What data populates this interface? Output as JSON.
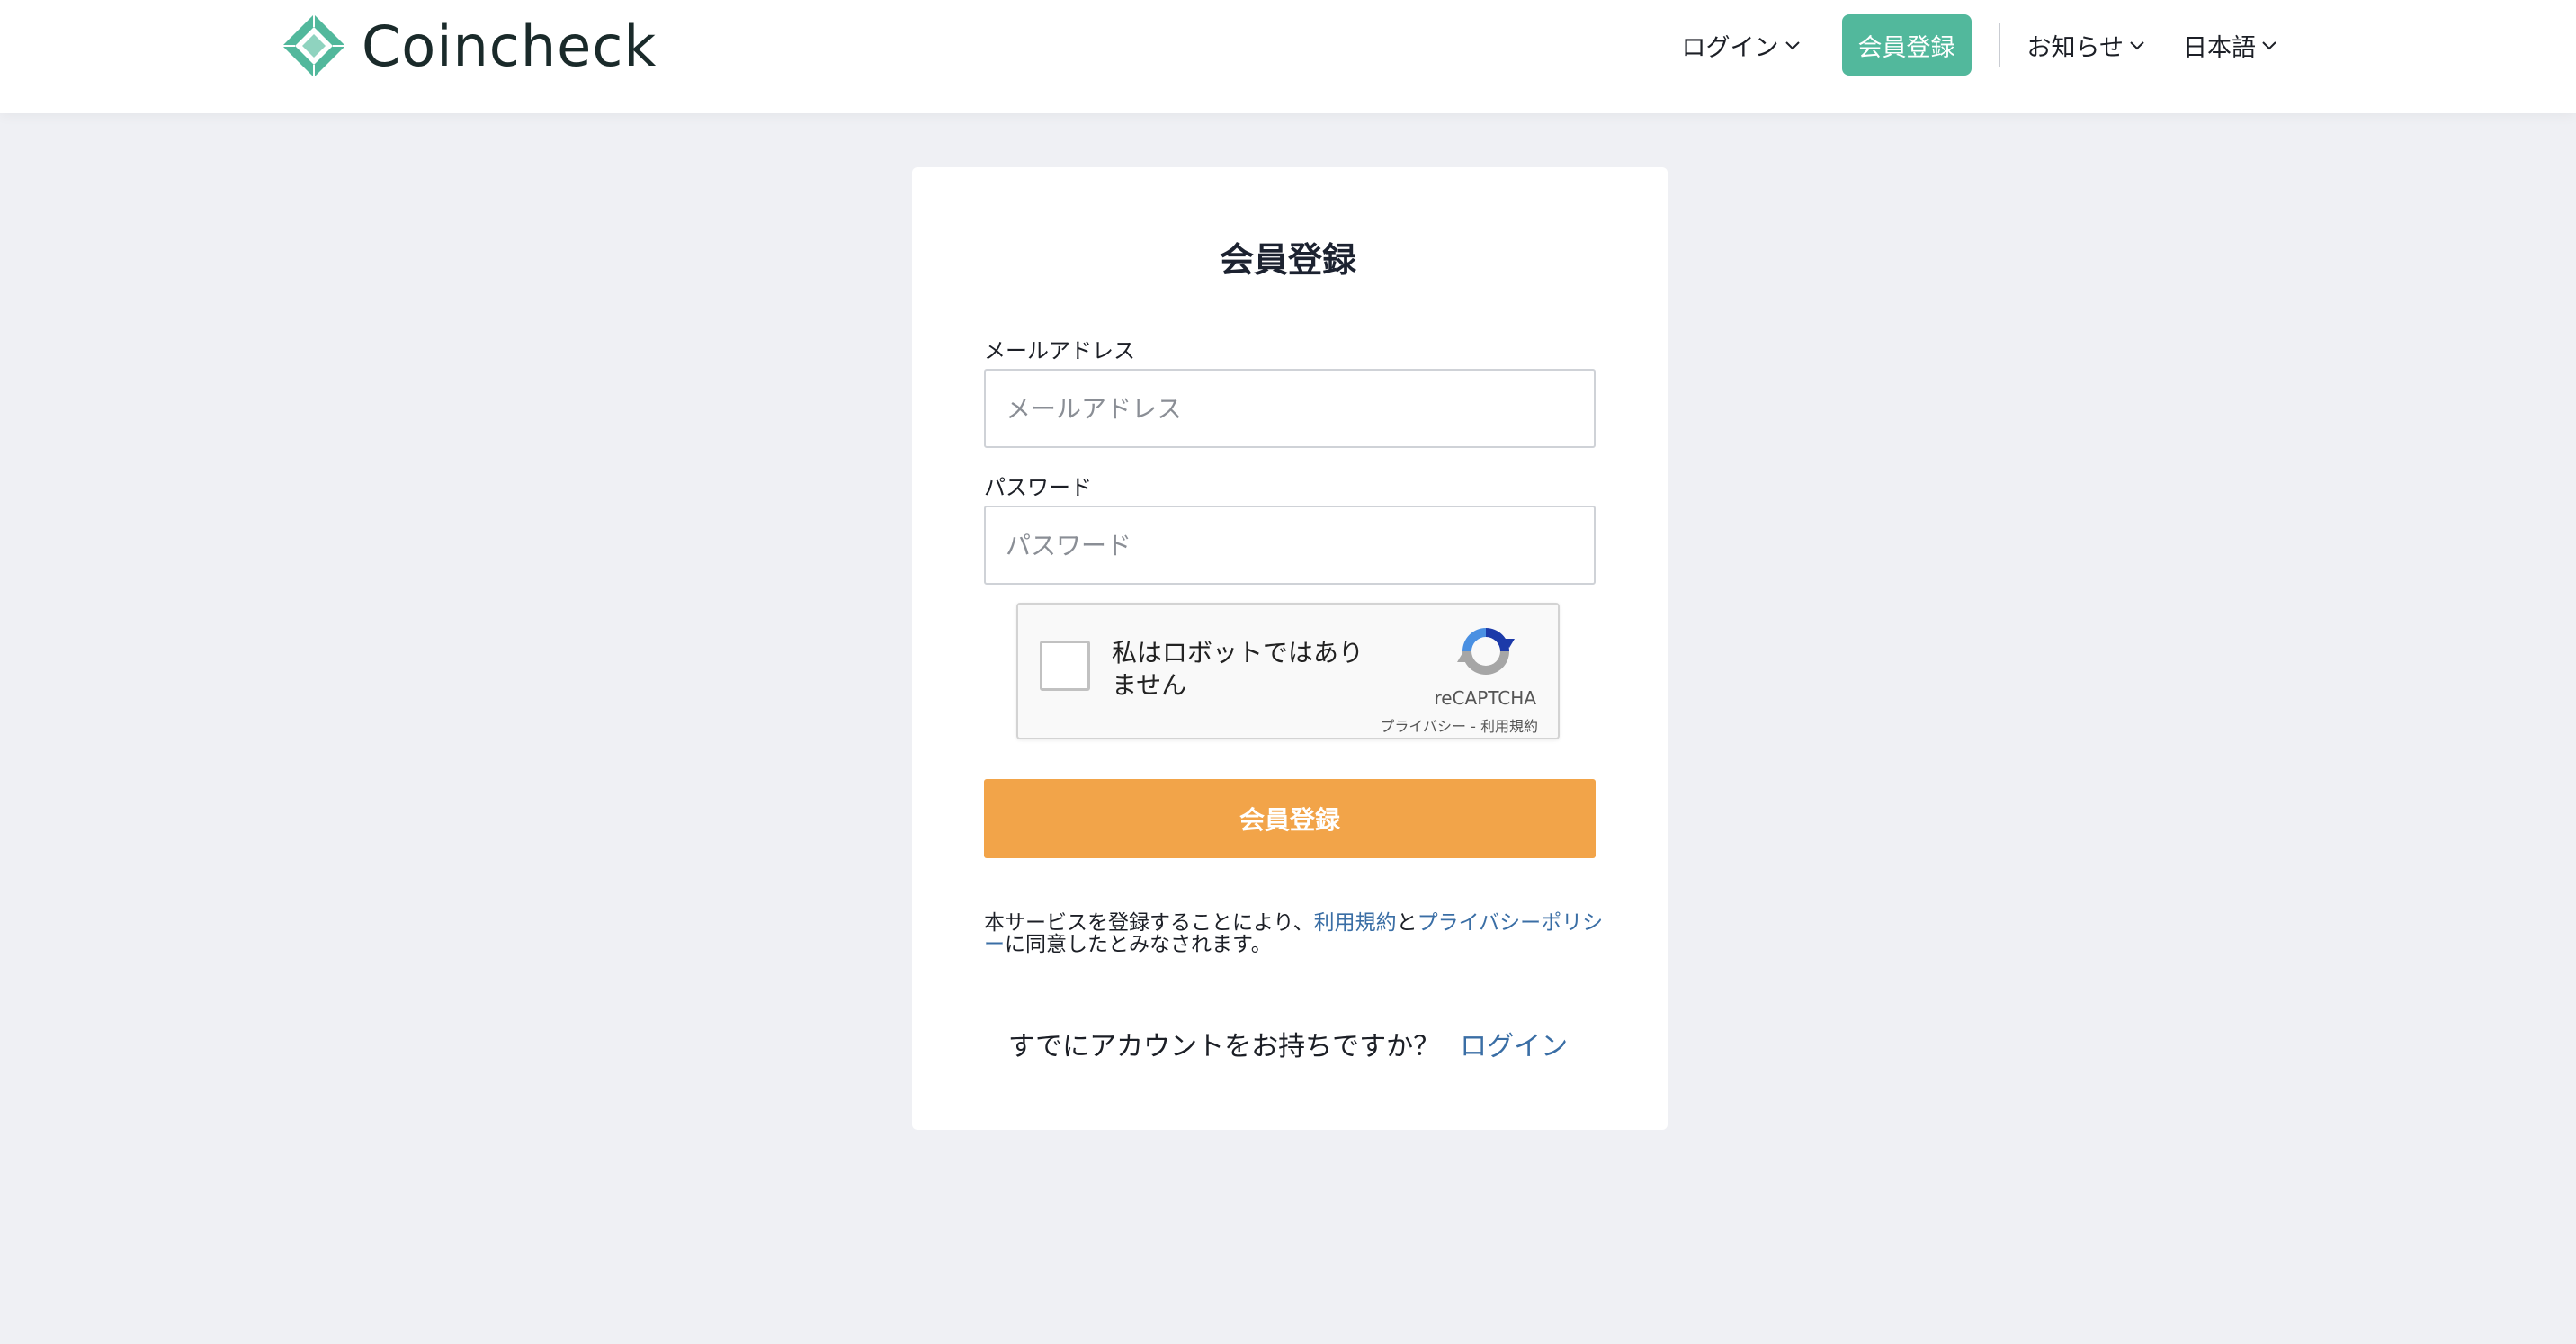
{
  "header": {
    "brand": "Coincheck",
    "nav": {
      "login": "ログイン",
      "signup": "会員登録",
      "news": "お知らせ",
      "language": "日本語"
    }
  },
  "form": {
    "title": "会員登録",
    "email_label": "メールアドレス",
    "email_placeholder": "メールアドレス",
    "email_value": "",
    "password_label": "パスワード",
    "password_placeholder": "パスワード",
    "password_value": "",
    "captcha": {
      "text": "私はロボットではありません",
      "brand": "reCAPTCHA",
      "privacy": "プライバシー",
      "separator": " - ",
      "terms": "利用規約"
    },
    "submit": "会員登録",
    "terms_text": {
      "prefix": "本サービスを登録することにより、",
      "terms_link": "利用規約",
      "and": "と",
      "privacy_link": "プライバシーポリシー",
      "suffix": "に同意したとみなされます。"
    },
    "already": {
      "question": "すでにアカウントをお持ちですか？",
      "login_link": "ログイン"
    }
  },
  "colors": {
    "brand_green": "#52b89c",
    "submit_orange": "#f2a449",
    "link_blue": "#3a6ea5",
    "background": "#eff0f4"
  }
}
